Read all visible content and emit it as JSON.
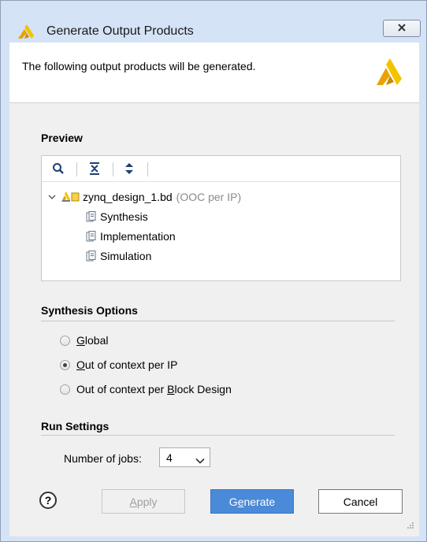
{
  "window": {
    "title": "Generate Output Products",
    "close_icon": "close-icon"
  },
  "header": {
    "message": "The following output products will be generated.",
    "logo_icon": "vivado-logo-icon"
  },
  "preview": {
    "title": "Preview",
    "toolbar": {
      "search_icon": "search-icon",
      "collapse_all_icon": "collapse-all-icon",
      "expand_all_icon": "expand-all-icon"
    },
    "tree": {
      "root": {
        "name": "zynq_design_1.bd",
        "note": "(OOC per IP)"
      },
      "children": [
        {
          "label": "Synthesis"
        },
        {
          "label": "Implementation"
        },
        {
          "label": "Simulation"
        }
      ]
    }
  },
  "synthesis_options": {
    "title": "Synthesis Options",
    "options": [
      {
        "label": "Global",
        "checked": false
      },
      {
        "label": "Out of context per IP",
        "checked": true
      },
      {
        "label": "Out of context per Block Design",
        "checked": false
      }
    ]
  },
  "run_settings": {
    "title": "Run Settings",
    "jobs_label": "Number of jobs:",
    "jobs_value": "4"
  },
  "buttons": {
    "help": "?",
    "apply": "Apply",
    "generate": "Generate",
    "cancel": "Cancel"
  },
  "colors": {
    "title_bg": "#d4e3f5",
    "primary_button": "#4a8ad8",
    "logo_yellow": "#f0b000"
  }
}
